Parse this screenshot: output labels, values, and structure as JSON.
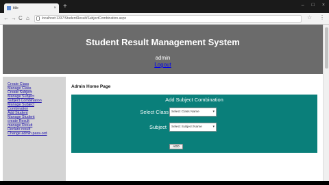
{
  "browser": {
    "tab_title": "title",
    "tab_close": "×",
    "new_tab": "+",
    "window_controls": [
      "–",
      "□",
      "×"
    ],
    "nav_icons": [
      "back-icon",
      "forward-icon",
      "reload-icon",
      "home-icon"
    ],
    "nav_glyphs": [
      "←",
      "→",
      "C",
      "⌂"
    ],
    "url": "localhost:1337/StudentResult/SubjectCombination.aspx",
    "star_glyph": "☆",
    "menu_glyph": "⋮"
  },
  "header": {
    "title": "Student Result Management System",
    "admin": "admin",
    "logout": "Logout",
    "bg_color": "#6b6b6b"
  },
  "sidebar": {
    "items": [
      "Create Class",
      "Manage Class",
      "Create Subject",
      "Manage Subject",
      "Subject Combination",
      "Manage Subject",
      "Combination",
      "Add Student",
      "Manage Student",
      "create Result",
      "manage Result",
      "Declare result",
      "Change admin pass-ord"
    ]
  },
  "main": {
    "title": "Admin Home Page",
    "panel": {
      "title": "Add Subject Combination",
      "class_label": "Select Class",
      "class_value": "Select Class Name",
      "subject_label": "Subject",
      "subject_value": "Select Subject Name",
      "add_button": "ADD",
      "bg_color": "#0a7f7a"
    }
  }
}
